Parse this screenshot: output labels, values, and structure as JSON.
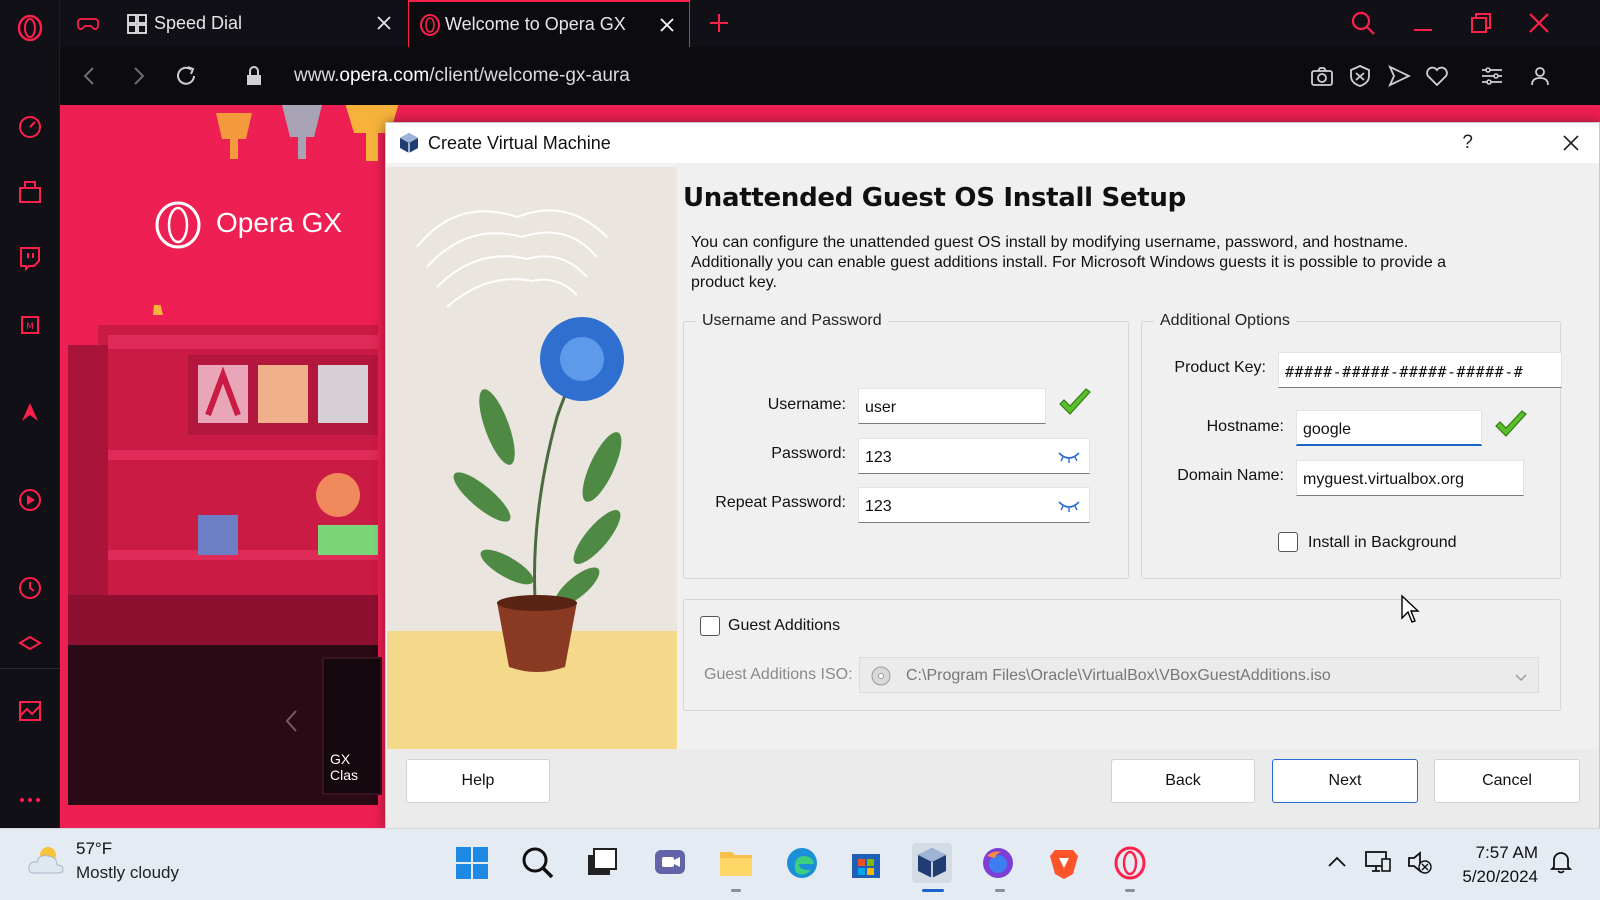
{
  "browser": {
    "tabs": [
      {
        "label": "Speed Dial"
      },
      {
        "label": "Welcome to Opera GX"
      }
    ],
    "url_prefix": "www.",
    "url_domain": "opera.com",
    "url_path": "/client/welcome-gx-aura",
    "page_brand": "Opera GX",
    "page_card_label": "GX Clas",
    "accent": "#ff1f4b"
  },
  "dialog": {
    "title": "Create Virtual Machine",
    "help_glyph": "?",
    "heading": "Unattended Guest OS Install Setup",
    "description": "You can configure the unattended guest OS install by modifying username, password, and hostname. Additionally you can enable guest additions install. For Microsoft Windows guests it is possible to provide a product key.",
    "user_group": {
      "title": "Username and Password",
      "username_label": "Username:",
      "username_value": "user",
      "password_label": "Password:",
      "password_value": "123",
      "repeat_label": "Repeat Password:",
      "repeat_value": "123"
    },
    "options_group": {
      "title": "Additional Options",
      "product_key_label": "Product Key:",
      "product_key_value": "#####-#####-#####-#####-#",
      "hostname_label": "Hostname:",
      "hostname_value": "google",
      "domain_label": "Domain Name:",
      "domain_value": "myguest.virtualbox.org",
      "install_bg_label": "Install in Background",
      "install_bg_checked": false
    },
    "guest_additions": {
      "label": "Guest Additions",
      "checked": false,
      "iso_label": "Guest Additions ISO:",
      "iso_value": "C:\\Program Files\\Oracle\\VirtualBox\\VBoxGuestAdditions.iso"
    },
    "buttons": {
      "help": "Help",
      "back": "Back",
      "next": "Next",
      "cancel": "Cancel"
    }
  },
  "taskbar": {
    "weather_temp": "57°F",
    "weather_condition": "Mostly cloudy",
    "time": "7:57 AM",
    "date": "5/20/2024"
  }
}
